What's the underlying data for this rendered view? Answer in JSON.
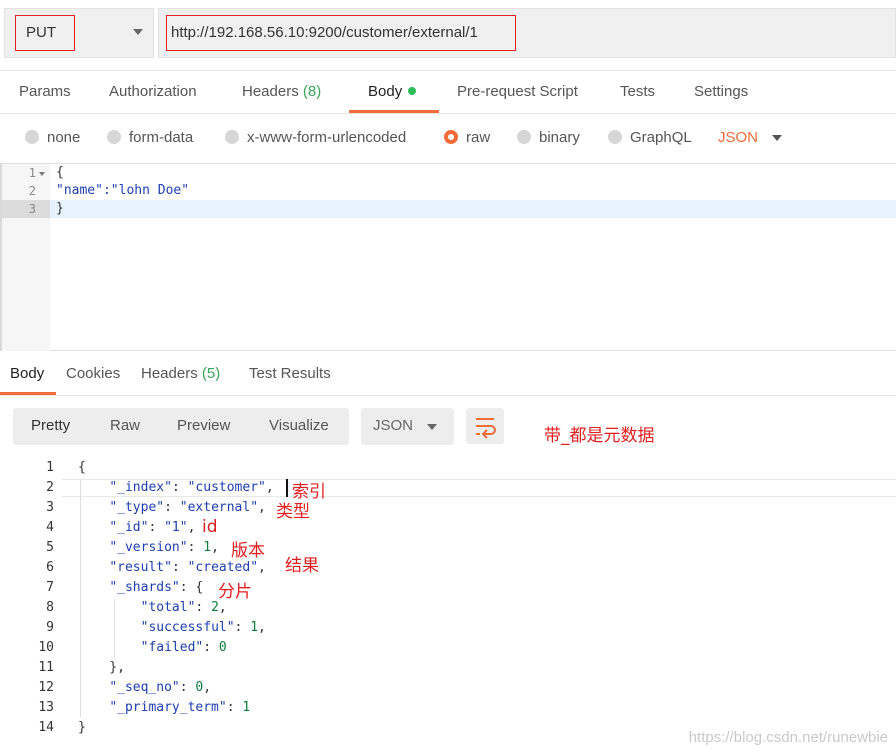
{
  "request": {
    "method": "PUT",
    "url": "http://192.168.56.10:9200/customer/external/1"
  },
  "request_tabs": [
    {
      "label": "Params"
    },
    {
      "label": "Authorization"
    },
    {
      "label": "Headers",
      "count": "(8)"
    },
    {
      "label": "Body"
    },
    {
      "label": "Pre-request Script"
    },
    {
      "label": "Tests"
    },
    {
      "label": "Settings"
    }
  ],
  "body_types": [
    "none",
    "form-data",
    "x-www-form-urlencoded",
    "raw",
    "binary",
    "GraphQL"
  ],
  "body_format": "JSON",
  "request_body": {
    "line_numbers": [
      "1",
      "2",
      "3"
    ],
    "lines": [
      "{",
      "\"name\":\"lohn Doe\"",
      "}"
    ]
  },
  "response_tabs": [
    {
      "label": "Body"
    },
    {
      "label": "Cookies"
    },
    {
      "label": "Headers",
      "count": "(5)"
    },
    {
      "label": "Test Results"
    }
  ],
  "view_modes": [
    "Pretty",
    "Raw",
    "Preview",
    "Visualize"
  ],
  "response_format": "JSON",
  "annotations": {
    "meta": "带_都是元数据",
    "index": "索引",
    "type": "类型",
    "id": "id",
    "version": "版本",
    "result": "结果",
    "shards": "分片"
  },
  "response_body": {
    "line_numbers": [
      "1",
      "2",
      "3",
      "4",
      "5",
      "6",
      "7",
      "8",
      "9",
      "10",
      "11",
      "12",
      "13",
      "14"
    ],
    "lines": [
      "{",
      "    \"_index\": \"customer\",",
      "    \"_type\": \"external\",",
      "    \"_id\": \"1\",",
      "    \"_version\": 1,",
      "    \"result\": \"created\",",
      "    \"_shards\": {",
      "        \"total\": 2,",
      "        \"successful\": 1,",
      "        \"failed\": 0",
      "    },",
      "    \"_seq_no\": 0,",
      "    \"_primary_term\": 1",
      "}"
    ]
  },
  "watermark": "https://blog.csdn.net/runewbie",
  "colors": {
    "accent": "#f26b3a",
    "annotation": "#e02020",
    "active_dot": "#2ebd59"
  }
}
